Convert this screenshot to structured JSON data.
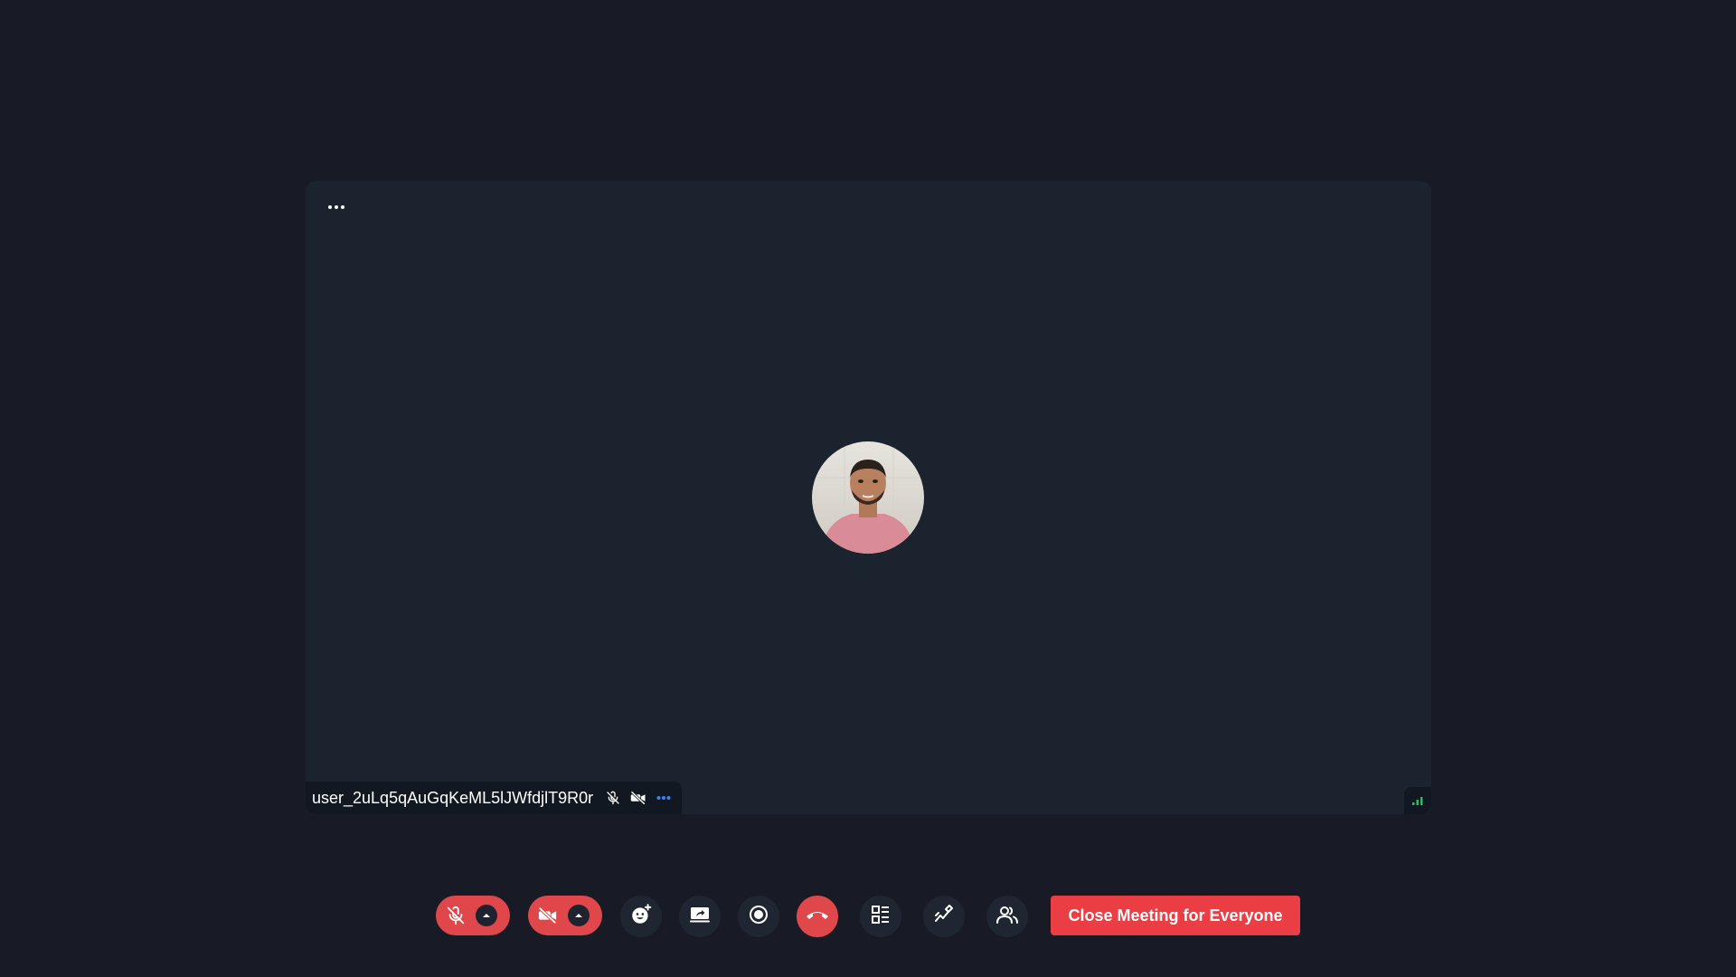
{
  "participant": {
    "name": "user_2uLq5qAuGqKeML5lJWfdjlT9R0r",
    "mic_status": "muted",
    "camera_status": "off"
  },
  "toolbar": {
    "mic_button": "mic-off",
    "camera_button": "camera-off",
    "reactions_button": "emoji",
    "share_screen_button": "screen-share",
    "record_button": "record",
    "leave_button": "hang-up",
    "layout_button": "layout",
    "whiteboard_button": "annotate",
    "participants_button": "participants",
    "close_meeting_label": "Close Meeting for Everyone"
  },
  "colors": {
    "background": "#181a25",
    "stage": "#1b232e",
    "accent_red": "#e0474a",
    "close_button": "#ea3e44",
    "signal_green": "#22c55e",
    "more_blue": "#3b82f6"
  }
}
